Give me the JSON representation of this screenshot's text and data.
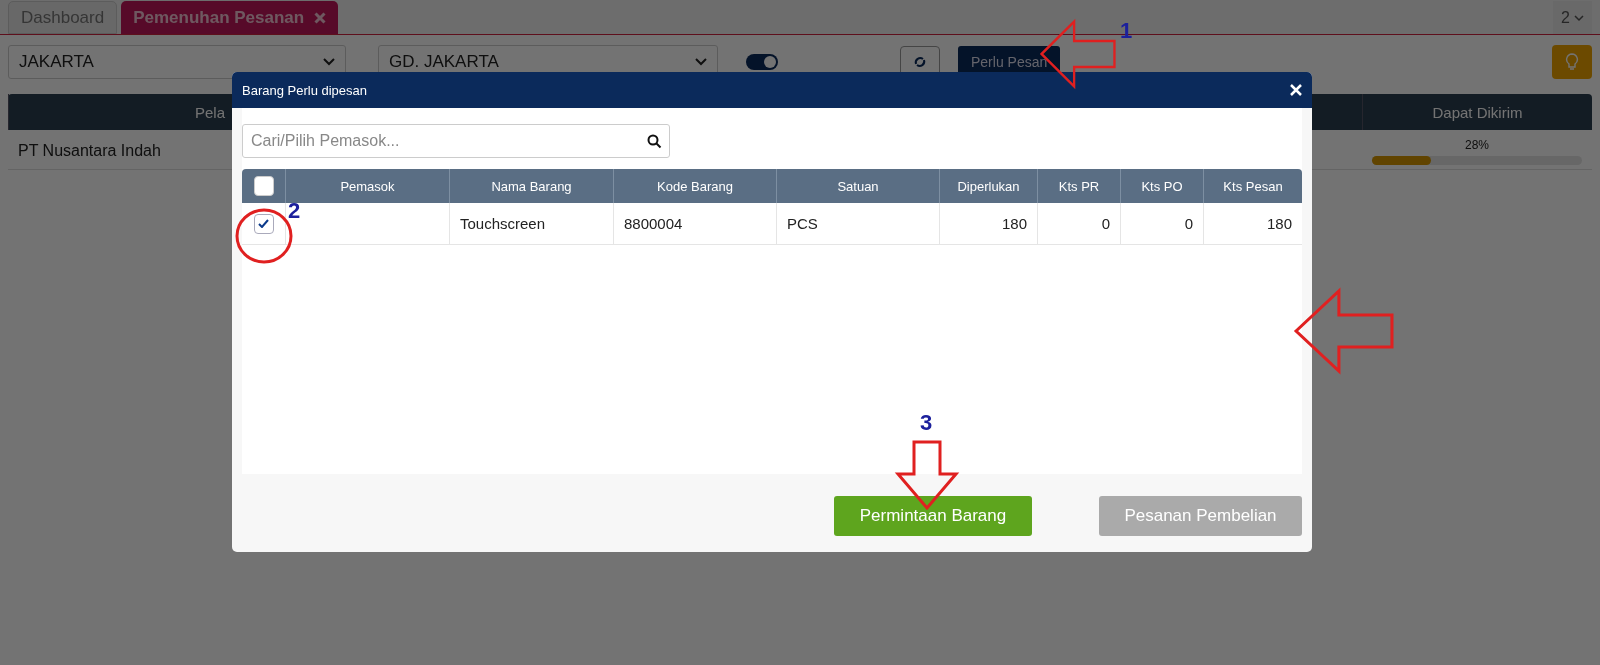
{
  "tabs": [
    {
      "label": "Dashboard",
      "selected": false,
      "closable": false
    },
    {
      "label": "Pemenuhan Pesanan",
      "selected": true,
      "closable": true
    }
  ],
  "tab_menu": "2",
  "filters": {
    "region": "JAKARTA",
    "warehouse": "GD. JAKARTA",
    "toggle_on": true,
    "need_order_button": "Perlu Pesan"
  },
  "background_table": {
    "columns": [
      "Pela",
      "Dapat Dikirim"
    ],
    "rows": [
      {
        "customer": "PT Nusantara Indah",
        "percent": "28%",
        "level": 0.28
      }
    ]
  },
  "dialog": {
    "title": "Barang Perlu dipesan",
    "search": {
      "placeholder": "Cari/Pilih Pemasok..."
    },
    "header_checked": false,
    "columns": [
      "Pemasok",
      "Nama Barang",
      "Kode Barang",
      "Satuan",
      "Diperlukan",
      "Kts PR",
      "Kts PO",
      "Kts Pesan"
    ],
    "rows": [
      {
        "selected": true,
        "cells": [
          "",
          "Touchscreen",
          "8800004",
          "PCS",
          "180",
          "0",
          "0",
          "180"
        ]
      }
    ],
    "buttons": [
      {
        "label": "Permintaan Barang",
        "kind": "primary"
      },
      {
        "label": "Pesanan Pembelian",
        "kind": "disabled"
      }
    ]
  },
  "annotations": [
    {
      "kind": "arrow-left",
      "label": "1"
    },
    {
      "kind": "circle",
      "label": "2"
    },
    {
      "kind": "arrow-left"
    },
    {
      "kind": "arrow-down",
      "label": "3"
    }
  ]
}
